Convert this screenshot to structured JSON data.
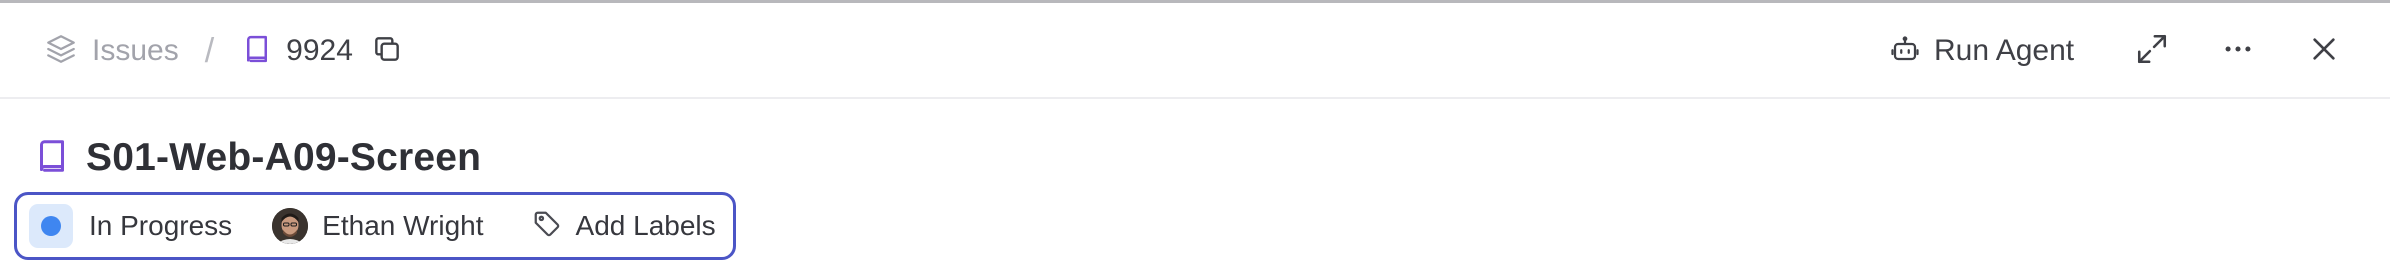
{
  "breadcrumb": {
    "issues_label": "Issues",
    "separator": "/",
    "issue_id": "9924"
  },
  "actions": {
    "run_agent_label": "Run Agent"
  },
  "issue": {
    "title": "S01-Web-A09-Screen",
    "status": "In Progress",
    "assignee": "Ethan Wright",
    "labels_action": "Add Labels"
  },
  "icons": {
    "issues": "layers-icon",
    "issue_type": "book-icon",
    "copy": "copy-icon",
    "run_agent": "robot-icon",
    "expand": "expand-icon",
    "more": "more-horizontal-icon",
    "close": "close-icon",
    "tag": "tag-icon",
    "status": "status-dot-icon"
  },
  "colors": {
    "accent_purple": "#7b4fd8",
    "status_blue": "#3f86f0",
    "focus_outline": "#4b55c6"
  }
}
